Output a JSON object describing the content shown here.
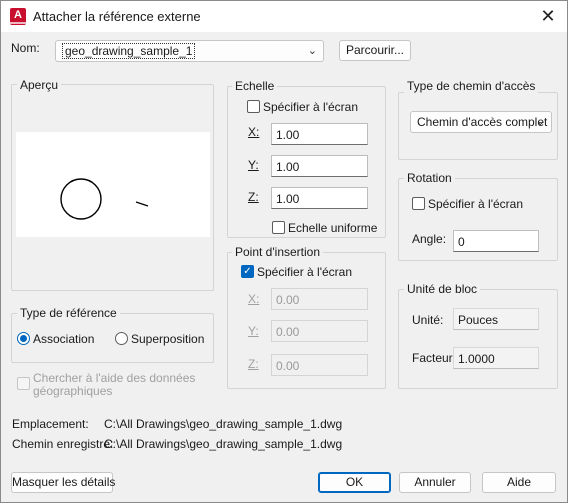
{
  "window": {
    "title": "Attacher la référence externe",
    "app_icon_letter": "A"
  },
  "name": {
    "label": "Nom:",
    "value": "geo_drawing_sample_1",
    "browse_label": "Parcourir..."
  },
  "preview": {
    "label": "Aperçu"
  },
  "scale": {
    "title": "Echelle",
    "specify_on_screen": "Spécifier à l'écran",
    "x_label": "X:",
    "x_value": "1.00",
    "y_label": "Y:",
    "y_value": "1.00",
    "z_label": "Z:",
    "z_value": "1.00",
    "uniform_label": "Echelle uniforme"
  },
  "path_type": {
    "title": "Type de chemin d'accès",
    "selected": "Chemin d'accès complet"
  },
  "rotation": {
    "title": "Rotation",
    "specify_on_screen": "Spécifier à l'écran",
    "angle_label": "Angle:",
    "angle_value": "0"
  },
  "insertion": {
    "title": "Point d'insertion",
    "specify_on_screen": "Spécifier à l'écran",
    "x_label": "X:",
    "x_value": "0.00",
    "y_label": "Y:",
    "y_value": "0.00",
    "z_label": "Z:",
    "z_value": "0.00"
  },
  "block_unit": {
    "title": "Unité de bloc",
    "unit_label": "Unité:",
    "unit_value": "Pouces",
    "factor_label": "Facteur:",
    "factor_value": "1.0000"
  },
  "ref_type": {
    "title": "Type de référence",
    "attachment": "Association",
    "overlay": "Superposition"
  },
  "geo_search": {
    "line1": "Chercher à l'aide des données",
    "line2": "géographiques"
  },
  "location": {
    "label": "Emplacement:",
    "value": "C:\\All Drawings\\geo_drawing_sample_1.dwg"
  },
  "saved_path": {
    "label": "Chemin enregistré:",
    "value": "C:\\All Drawings\\geo_drawing_sample_1.dwg"
  },
  "buttons": {
    "hide_details": "Masquer les détails",
    "ok": "OK",
    "cancel": "Annuler",
    "help": "Aide"
  }
}
